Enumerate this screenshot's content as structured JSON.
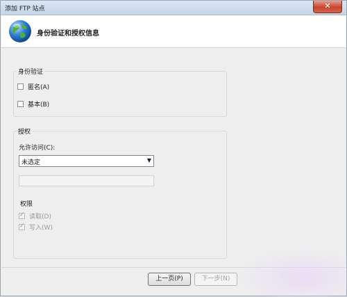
{
  "window": {
    "title": "添加 FTP 站点",
    "close_icon": "close-icon"
  },
  "header": {
    "title": "身份验证和授权信息",
    "icon": "globe-icon"
  },
  "authentication": {
    "label": "身份验证",
    "anonymous": {
      "label": "匿名(A)",
      "checked": false
    },
    "basic": {
      "label": "基本(B)",
      "checked": false
    }
  },
  "authorization": {
    "label": "授权",
    "allow_access_label": "允许访问(C):",
    "allow_access_value": "未选定",
    "user_text": "",
    "permissions": {
      "label": "权限",
      "read": {
        "label": "读取(D)",
        "checked": true,
        "enabled": false
      },
      "write": {
        "label": "写入(W)",
        "checked": true,
        "enabled": false
      }
    }
  },
  "buttons": {
    "prev": "上一页(P)",
    "next": "下一步(N)"
  },
  "colors": {
    "title_bar": "#c5d5e8",
    "close_button": "#c9432b",
    "dialog_bg": "#eeeeee"
  }
}
